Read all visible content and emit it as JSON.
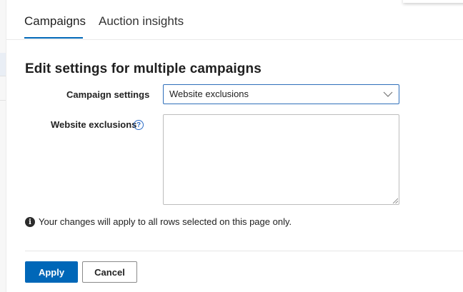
{
  "tabs": [
    {
      "label": "Campaigns",
      "active": true
    },
    {
      "label": "Auction insights",
      "active": false
    }
  ],
  "heading": "Edit settings for multiple campaigns",
  "form": {
    "campaign_settings_label": "Campaign settings",
    "campaign_settings_value": "Website exclusions",
    "website_exclusions_label": "Website exclusions",
    "website_exclusions_value": "",
    "help_glyph": "?"
  },
  "info": {
    "glyph": "i",
    "text": "Your changes will apply to all rows selected on this page only."
  },
  "buttons": {
    "apply": "Apply",
    "cancel": "Cancel"
  },
  "colors": {
    "accent": "#0067b8",
    "select_border": "#2f6fba"
  },
  "icons": [
    "question-help-icon",
    "chevron-down-icon",
    "info-icon",
    "resize-grip-icon"
  ]
}
